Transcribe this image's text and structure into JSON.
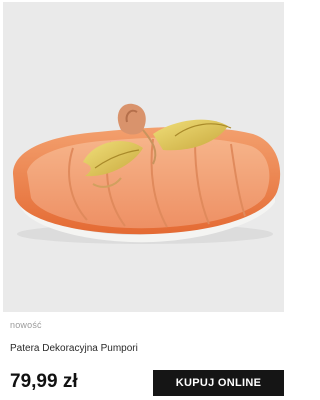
{
  "product": {
    "badge": "nowość",
    "name": "Patera Dekoracyjna Pumpori",
    "price": "79,99 zł",
    "buy_label": "KUPUJ ONLINE",
    "image_icon": "pumpkin-platter"
  },
  "colors": {
    "image_background": "#eaeaea",
    "pumpkin_orange": "#f09a6a",
    "leaf_yellow": "#e3c85a",
    "button_background": "#151515"
  }
}
